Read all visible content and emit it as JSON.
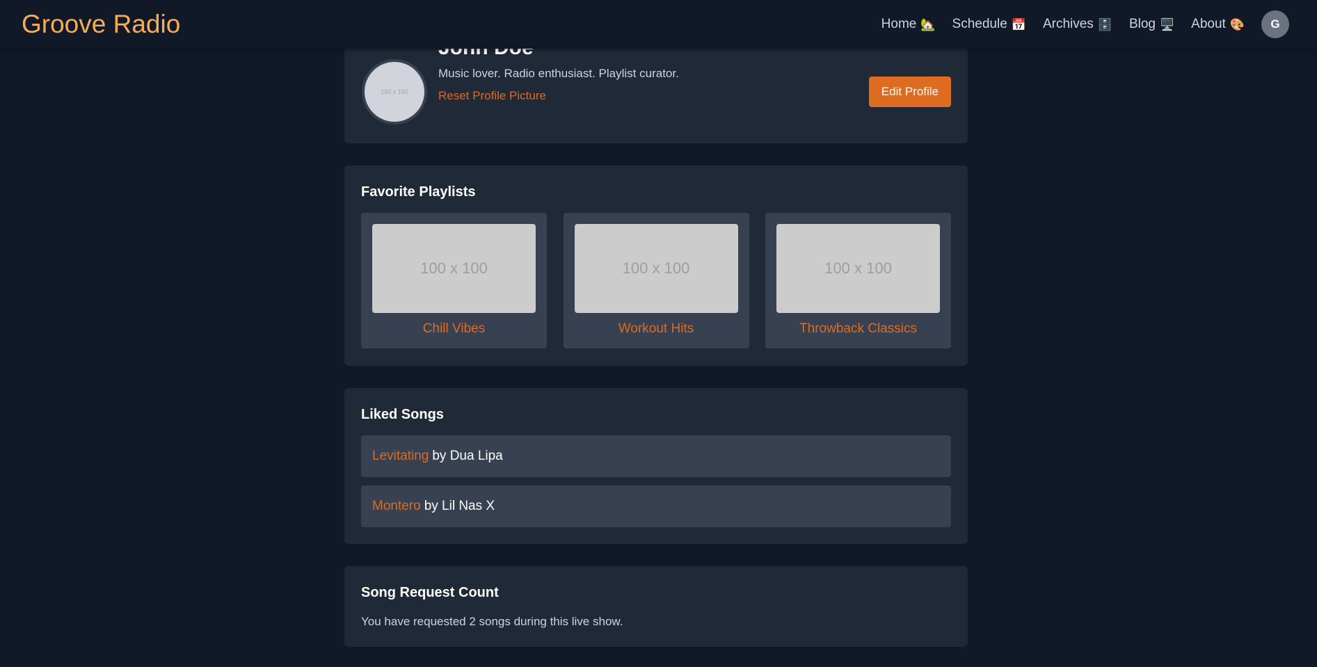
{
  "header": {
    "logo": "Groove Radio",
    "nav": [
      {
        "label": "Home",
        "emoji": "🏡"
      },
      {
        "label": "Schedule",
        "emoji": "📅"
      },
      {
        "label": "Archives",
        "emoji": "🗄️"
      },
      {
        "label": "Blog",
        "emoji": "🖥️"
      },
      {
        "label": "About",
        "emoji": "🎨"
      }
    ],
    "avatar_initial": "G"
  },
  "profile": {
    "picture_placeholder": "150 x 150",
    "name": "John Doe",
    "bio": "Music lover. Radio enthusiast. Playlist curator.",
    "reset_link": "Reset Profile Picture",
    "edit_button": "Edit Profile"
  },
  "playlists": {
    "title": "Favorite Playlists",
    "items": [
      {
        "thumb": "100 x 100",
        "name": "Chill Vibes"
      },
      {
        "thumb": "100 x 100",
        "name": "Workout Hits"
      },
      {
        "thumb": "100 x 100",
        "name": "Throwback Classics"
      }
    ]
  },
  "liked_songs": {
    "title": "Liked Songs",
    "items": [
      {
        "title": "Levitating",
        "artist_text": "by Dua Lipa"
      },
      {
        "title": "Montero",
        "artist_text": "by Lil Nas X"
      }
    ]
  },
  "request_count": {
    "title": "Song Request Count",
    "text": "You have requested 2 songs during this live show."
  },
  "colors": {
    "background": "#111827",
    "card": "#1f2937",
    "inner_card": "#374151",
    "accent": "#dd6b20",
    "logo": "#f6ad55"
  }
}
